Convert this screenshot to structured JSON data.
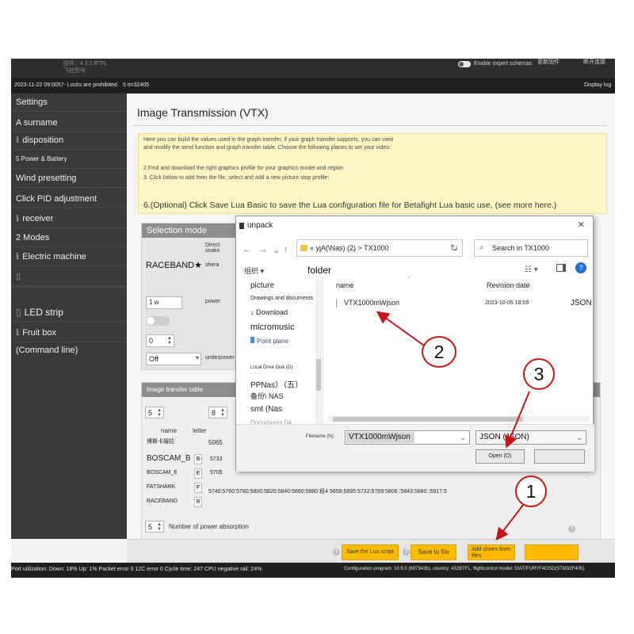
{
  "topbar": {
    "left_line1": "固件：4.3.2 BTFL",
    "left_line2": "飞控型号",
    "expert_label": "Enable expert schemas",
    "right_item1": "更新固件",
    "right_item2": "断开连接"
  },
  "statusline": {
    "left": "2023-11-22 09:0057- Locks are prohibited",
    "middle": "5 tm32405",
    "right": "Display log"
  },
  "sidebar": {
    "items": [
      {
        "label": "Settings",
        "glyph": ""
      },
      {
        "label": "A surname",
        "glyph": ""
      },
      {
        "label": "disposition",
        "glyph": "ℹ"
      },
      {
        "label": "5 Power & Battery",
        "glyph": ""
      },
      {
        "label": "Wind presetting",
        "glyph": ""
      },
      {
        "label": "Click PID adjustment",
        "glyph": ""
      },
      {
        "label": "receiver",
        "glyph": "ℹ"
      },
      {
        "label": "2 Modes",
        "glyph": ""
      },
      {
        "label": "Electric machine",
        "glyph": "ℹ"
      },
      {
        "label": "",
        "glyph": "▯"
      },
      {
        "label": "",
        "glyph": ""
      },
      {
        "label": "LED strip",
        "glyph": "▯"
      },
      {
        "label": "Fruit box",
        "glyph": "ℹ"
      },
      {
        "label": "(Command line)",
        "glyph": ""
      }
    ]
  },
  "page": {
    "title": "Image Transmission (VTX)",
    "note": {
      "line1": "Here you can build the values used in the graph transfer, if your graph transfer supports, you can view",
      "line2": "and modify the send function and graph transfer table. Choose the following places to set your video:",
      "line3": "2 Find and download the right graphics profile for your graphics model and region:",
      "line4": "3. Click below to add from the file, select and add a new picture stop profile:",
      "line5": "6.(Optional) Click Save Lua Basic to save the Lua configuration file for Betafight Lua basic use, (see more here.)"
    }
  },
  "selection": {
    "title": "Selection mode",
    "row1_label": "Direct snake",
    "band_value": "RACEBAND★",
    "band_label": "shera",
    "power_value": "1 w",
    "power_label": "power",
    "channel_value": "0",
    "pit_value": "Off",
    "pit_label": "underpower"
  },
  "vtx_table": {
    "title": "Image transfer table",
    "bands_count": "5",
    "channels_count": "8",
    "col_name": "name",
    "col_letter": "letter",
    "rows": [
      {
        "name": "博斯卡姆拉",
        "letter": "",
        "freq": "5065"
      },
      {
        "name": "BOSCAM_B",
        "letter": "B",
        "freq": "5733"
      },
      {
        "name": "BOSCAM_E",
        "letter": "E",
        "freq": "5705"
      },
      {
        "name": "FATSHARK",
        "letter": "F",
        "freq": ""
      },
      {
        "name": "RACEBAND",
        "letter": "R",
        "freq": ""
      }
    ],
    "freq_line": "5740:5760:5780:5800:5820:5840:5860:5880:段4 5658:5695:5732:5769:5806 :5843:5880 :5917:5",
    "power_count": "5",
    "power_label": "Number of power absorption"
  },
  "bottom_buttons": {
    "save_lua": "Save the Lua script",
    "save_file": "Save to file",
    "load_file": "Add shoes from files",
    "extra": ""
  },
  "footer": {
    "left": "Port utilization: Down: 18% Up: 1% Packet error 0 12C error 0 Cycle time: 247 CPU negative rail: 24%",
    "right": "Configuration program: 10.9.0 (697943b), country: 432BTFL, flightcontrol model: DIAT/FURYF4OSD(STM32F405)"
  },
  "dialog": {
    "title": "unpack",
    "address": "« yjA(\\Nas)    (2)  > TX1000",
    "search_placeholder": "Search in TX1000",
    "organize": "组织 ▾",
    "new_folder": "folder",
    "nav_items": [
      "picture",
      "Drawings and documents",
      "↓ Download",
      "micromusic",
      "Point plane",
      "Local Drive Disk (D)",
      "PPNas）（五）",
      "备份\\ NAS",
      "smt (Nas",
      "Documents 04"
    ],
    "col_name": "name",
    "col_date": "Revision date",
    "file_name": "VTX1000mWjson",
    "file_date": "2023-10-05 18:09",
    "file_type": "JSON",
    "filename_label": "Filename (N):",
    "filename_value": "VTX1000mWjson",
    "filetype_value": "JSON (JSON)",
    "open_label": "Open (O)",
    "cancel_label": ""
  },
  "annotations": {
    "c1": "1",
    "c2": "2",
    "c3": "3",
    "color": "#c41818"
  }
}
